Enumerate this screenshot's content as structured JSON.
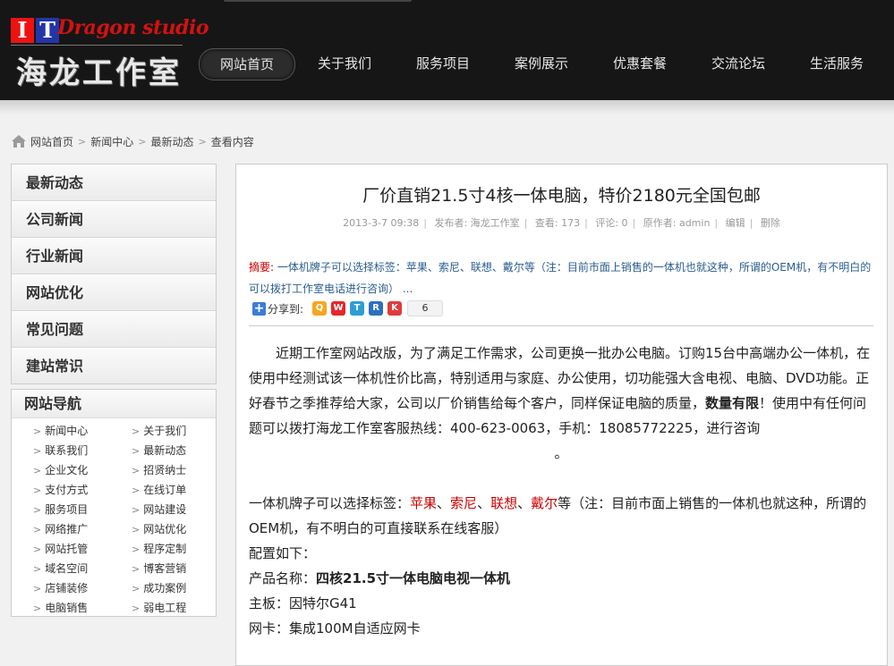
{
  "header": {
    "logo_it_i": "I",
    "logo_it_t": "T",
    "logo_dragon": "Dragon studio",
    "logo_cn": "海龙工作室",
    "nav": [
      "网站首页",
      "关于我们",
      "服务项目",
      "案例展示",
      "优惠套餐",
      "交流论坛",
      "生活服务"
    ]
  },
  "breadcrumb": [
    "网站首页",
    "新闻中心",
    "最新动态",
    "查看内容"
  ],
  "sidebar": {
    "categories": [
      "最新动态",
      "公司新闻",
      "行业新闻",
      "网站优化",
      "常见问题",
      "建站常识"
    ],
    "nav_title": "网站导航",
    "nav_links": [
      "新闻中心",
      "关于我们",
      "联系我们",
      "最新动态",
      "企业文化",
      "招贤纳士",
      "支付方式",
      "在线订单",
      "服务项目",
      "网站建设",
      "网络推广",
      "网站优化",
      "网站托管",
      "程序定制",
      "域名空间",
      "博客营销",
      "店铺装修",
      "成功案例",
      "电脑销售",
      "弱电工程"
    ]
  },
  "article": {
    "title": "厂价直销21.5寸4核一体电脑，特价2180元全国包邮",
    "meta": {
      "date": "2013-3-7 09:38",
      "publisher": "发布者: 海龙工作室",
      "views": "查看: 173",
      "comments": "评论: 0",
      "author": "原作者: admin",
      "edit": "编辑",
      "delete": "删除"
    },
    "summary_label": "摘要:",
    "summary_text": " 一体机牌子可以选择标签：苹果、索尼、联想、戴尔等（注：目前市面上销售的一体机也就这种，所谓的OEM机，有不明白的可以拨打工作室电话进行咨询） ...",
    "share_label": "分享到:",
    "share_count": "6",
    "para1_a": "近期工作室网站改版，为了满足工作需求，公司更换一批办公电脑。订购15台中高端办公一体机，在使用中经测试该一体机性价比高，特别适用与家庭、办公使用，切功能强大含电视、电脑、DVD功能。正好春节之季推荐给大家，公司以厂价销售给每个客户，同样保证电脑的质量，",
    "para1_bold": "数量有限",
    "para1_b": "！使用中有任何问题可以拨打海龙工作室客服热线：400-623-0063，手机：18085772225，进行咨询",
    "para1_end": "。",
    "para2_a": "一体机牌子可以选择标签：",
    "brand1": "苹果",
    "sep": "、",
    "brand2": "索尼",
    "brand3": "联想",
    "brand4": "戴尔",
    "para2_b": "等（注：目前市面上销售的一体机也就这种，所谓的OEM机，有不明白的可直接联系在线客服）",
    "config_label": "配置如下：",
    "product_label": "产品名称：",
    "product_name": "四核21.5寸一体电脑电视一体机",
    "board": "主板：因特尔G41",
    "nic": "网卡：集成100M自适应网卡"
  }
}
